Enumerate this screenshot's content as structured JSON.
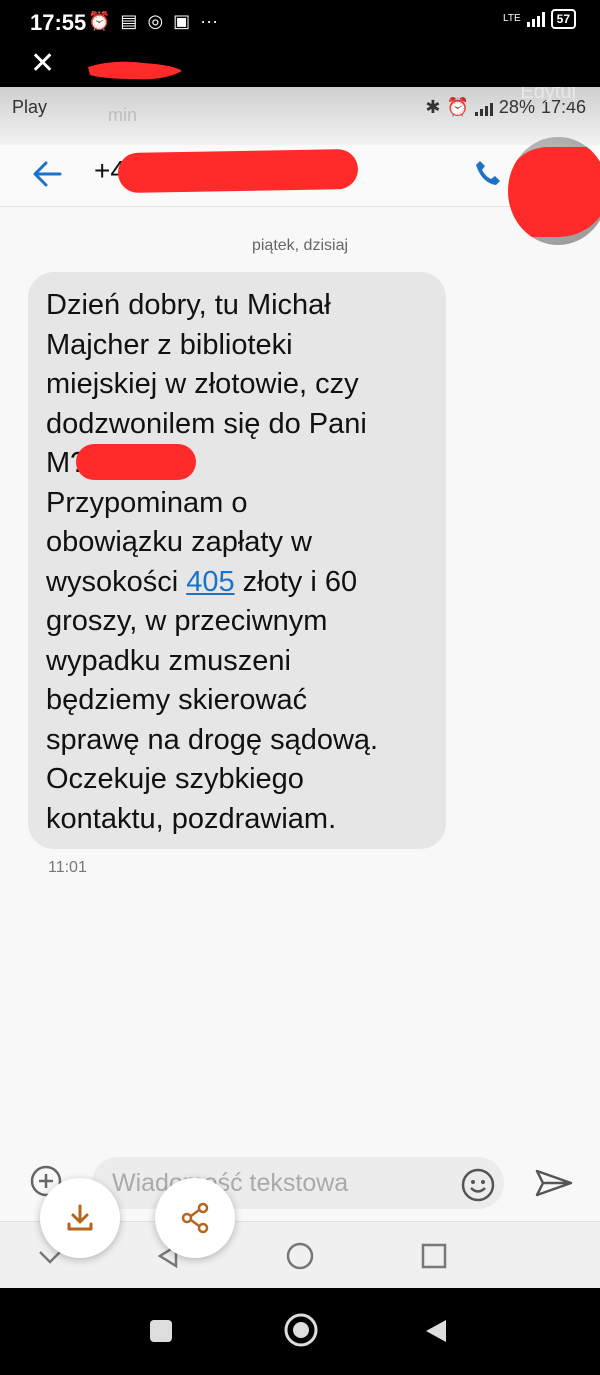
{
  "outer_status": {
    "time": "17:55",
    "network": "LTE",
    "battery": "57"
  },
  "viewer": {
    "close_glyph": "✕",
    "edit_label": "Edytuj"
  },
  "inner_status": {
    "carrier": "Play",
    "time_ago": "min",
    "battery": "28%",
    "time": "17:46"
  },
  "conversation": {
    "contact_prefix": "+48",
    "date_divider": "piątek, dzisiaj",
    "message": {
      "part1": "Dzień dobry, tu Michał\nMajcher z biblioteki\nmiejskiej w złotowie, czy\ndodzwonilem się do Pani\nM",
      "part2": "?\nPrzypominam o\nobowiązku zapłaty w\nwysokości ",
      "amount_link": "405",
      "part3": " złoty i 60\ngroszy, w przeciwnym\nwypadku zmuszeni\nbędziemy skierować\nsprawę na drogę sądową.\nOczekuje szybkiego\nkontaktu, pozdrawiam.",
      "time": "11:01"
    }
  },
  "composer": {
    "placeholder": "Wiadomość tekstowa"
  },
  "icons": {
    "back": "arrow-left-icon",
    "call": "phone-icon",
    "add": "plus-circle-icon",
    "emoji": "smiley-icon",
    "send": "send-icon",
    "download": "download-icon",
    "share": "share-icon"
  },
  "colors": {
    "accent": "#1a73c8",
    "bubble": "#e6e6e6",
    "redaction": "#ff2a2a",
    "fab_icon": "#b5651d"
  }
}
